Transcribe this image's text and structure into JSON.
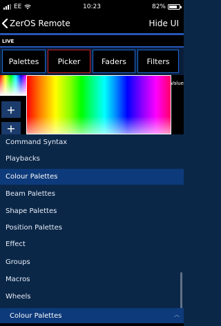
{
  "status_bar": {
    "carrier": "EE",
    "time": "10:23",
    "battery": "82%",
    "battery_level": 0.82,
    "icons": [
      "signal-icon",
      "wifi-icon",
      "battery-icon"
    ]
  },
  "nav": {
    "back_label": "ZerOS Remote",
    "right_action": "Hide UI"
  },
  "live": {
    "label": "LIVE"
  },
  "tabs": [
    {
      "label": "Palettes"
    },
    {
      "label": "Picker"
    },
    {
      "label": "Faders"
    },
    {
      "label": "Filters"
    }
  ],
  "picker": {
    "value_label": "Value",
    "add_buttons": [
      "+",
      "+"
    ]
  },
  "menu": {
    "items": [
      {
        "label": "Command Syntax"
      },
      {
        "label": "Playbacks"
      },
      {
        "label": "Colour Palettes"
      },
      {
        "label": "Beam Palettes"
      },
      {
        "label": "Shape Palettes"
      },
      {
        "label": "Position Palettes"
      },
      {
        "label": "Effect"
      },
      {
        "label": "Groups"
      },
      {
        "label": "Macros"
      },
      {
        "label": "Wheels"
      }
    ],
    "selected": "Colour Palettes"
  },
  "bottom_select": {
    "value": "Colour Palettes"
  },
  "colors": {
    "background": "#0b2748",
    "accent": "#2756b8",
    "selected_row": "#0d3a7a",
    "active_tab_border": "#cc2020",
    "tab_border": "#1f6bd6"
  }
}
